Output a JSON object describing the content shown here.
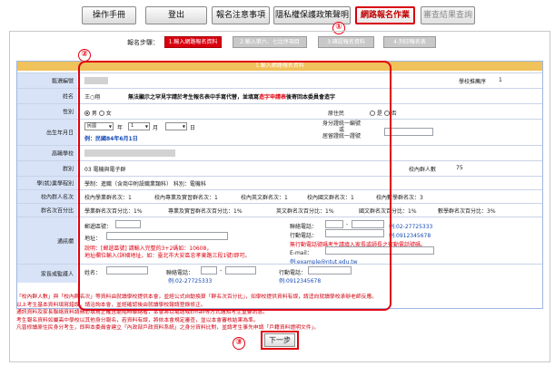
{
  "nav": {
    "items": [
      "操作手冊",
      "登出",
      "報名注意事項",
      "隱私權保護政策聲明",
      "網路報名作業",
      "審查結果查詢"
    ]
  },
  "markers": [
    "①",
    "②",
    "③"
  ],
  "steps": {
    "label": "報名步驟：",
    "items": [
      "1.輸入網路報名資料",
      "2.輸入第六、七比序項目",
      "3.確認報名資料",
      "4.列印報名表"
    ]
  },
  "panel": {
    "title": "1.輸入網路報名資料"
  },
  "form": {
    "exam_id_label": "甄選編號",
    "school_code_label": "學校推薦序",
    "school_code_value": "1",
    "name_label": "姓名",
    "name_value": "王○翔",
    "name_notice": "無法顯示之罕見字請於考生報名表中手寫代替，並填寫",
    "name_notice_link": "造字申請表",
    "name_notice_tail": "後寄回本委員會造字",
    "gender_label": "性別",
    "gender_male": "男",
    "gender_female": "女",
    "aboriginal_label": "原住民",
    "aboriginal_yes": "是",
    "aboriginal_no": "否",
    "dob_label": "出生年月日",
    "dob_era": "民國",
    "dob_year_unit": "年",
    "dob_month": "1",
    "dob_month_unit": "月",
    "dob_day_unit": "日",
    "dob_example": "例：民國84年6月1日",
    "id_label_1": "身分證統一編號",
    "id_label_2": "或",
    "id_label_3": "居留證統一證號",
    "school_label": "高職學校",
    "dept_label": "群別",
    "dept_value": "03 電機與電子群",
    "rank_label": "校內群人數",
    "rank_value": "75",
    "program_label": "學(就)業學程別",
    "program_value": "學制：進職（含商中附設職業類科）  科別：電機科",
    "quota_label": "校內群人名次",
    "quota_values": [
      "校內學業群名次：1",
      "校內專業及實習群名次：1",
      "校內英文群名次：1",
      "校內國文群名次：1",
      "校內數學群名次：3"
    ],
    "percent_label": "群名次百分比",
    "percent_values": [
      "學業群名次百分比：1%",
      "專業及實習群名次百分比：1%",
      "英文群名次百分比：1%",
      "國文群名次百分比：1%",
      "數學群名次百分比：3%"
    ],
    "contact_label": "通訊欄",
    "postal_label": "郵遞區號：",
    "address_label": "地址：",
    "address_note_1": "說明：",
    "address_note_2": "[郵遞區號] 請輸入完整的3+2碼如：10608，",
    "address_note_3": "地址欄位輸入(詳細地址，如：臺北市大安區忠孝東路三段1號)即可。",
    "phone_label": "聯絡電話：",
    "phone_example": "例:02-27725333",
    "mobile_label": "行動電話：",
    "mobile_example": "例:0912345678",
    "mobile_note": "無行動電話號碼考生請填入家長或師長之行動電話號碼。",
    "email_label": "E-mail：",
    "email_example": "例:example@ntut.edu.tw",
    "parent_label": "家長或監護人",
    "parent_name_label": "姓名：",
    "parent_phone_label": "聯絡電話：",
    "parent_phone_example": "例:02-27725333",
    "parent_mobile_label": "行動電話：",
    "parent_mobile_example": "例:0912345678"
  },
  "notes": [
    "「校內群人數」與「校內群名次」等資料由就讀學校提供本會，並經公式自動換算「群名次百分比」，如學校提供資料有誤，請逕向就讀學校承辦老師反應。",
    "以上考生基本資料填寫錯誤，請洽詢本會，並經確認後由就讀學校報請登錄修正。",
    "通訊資料及家長聯絡資料請務必填寫正確且能隨時聯絡者，本會將以電話或Email等方式通知考生重要訊息。",
    "考生報名資料如屬高中學校以其他身分報名，若資料有誤，將依本會規定審查，並以本會審核結果為準。",
    "凡曾修讀原住民身分考生，即與本委員會建立「內政部戶政資料系統」之身分資料比對，並請考生事先申請「戶籍資料證明文件」。"
  ],
  "next_button": "下一步"
}
